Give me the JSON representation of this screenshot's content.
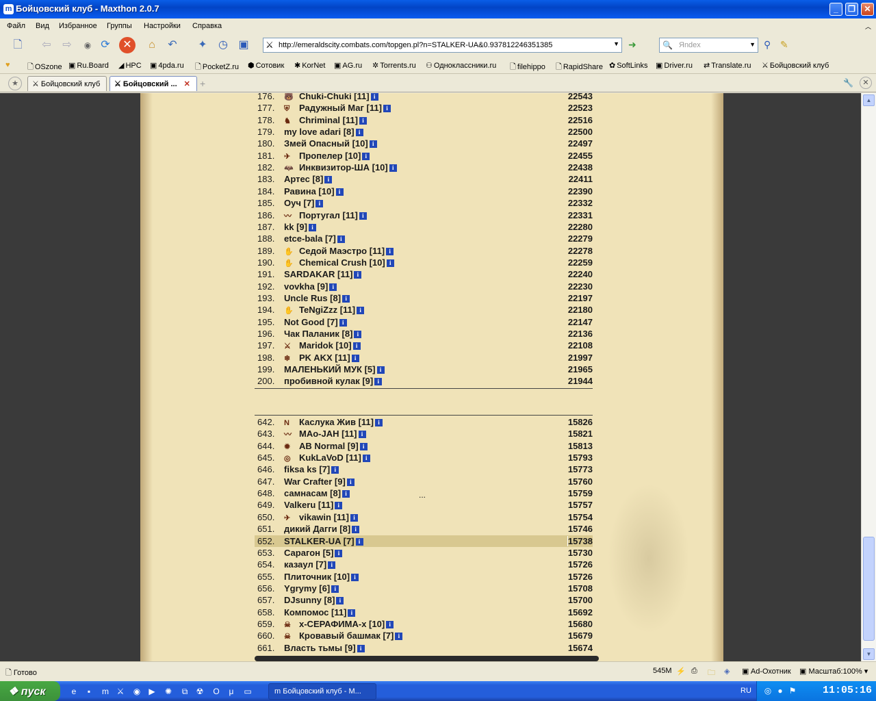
{
  "window": {
    "title": "Бойцовский клуб - Maxthon 2.0.7",
    "app_icon": "m"
  },
  "menu": [
    "Файл",
    "Вид",
    "Избранное",
    "Группы",
    "Настройки",
    "Справка"
  ],
  "address": {
    "url": "http://emeraldscity.combats.com/topgen.pl?n=STALKER-UA&0.937812246351385"
  },
  "search": {
    "placeholder": "Яndex"
  },
  "links": [
    "OSzone",
    "Ru.Board",
    "HPC",
    "4pda.ru",
    "PocketZ.ru",
    "Сотовик",
    "KorNet",
    "AG.ru",
    "Torrents.ru",
    "Одноклассники.ru",
    "filehippo",
    "RapidShare",
    "SoftLinks",
    "Driver.ru",
    "Translate.ru",
    "Бойцовский клуб"
  ],
  "tabs": [
    {
      "label": "Бойцовский клуб"
    },
    {
      "label": "Бойцовский ..."
    }
  ],
  "ranking_top": [
    {
      "rank": "176.",
      "name": "Chuki-Chuki [11]",
      "score": "22543",
      "icon": "🐻"
    },
    {
      "rank": "177.",
      "name": "Радужный Маг [11]",
      "score": "22523",
      "icon": "⛨"
    },
    {
      "rank": "178.",
      "name": "Chriminal [11]",
      "score": "22516",
      "icon": "♞"
    },
    {
      "rank": "179.",
      "name": "my love adari [8]",
      "score": "22500",
      "icon": ""
    },
    {
      "rank": "180.",
      "name": "Змей Опасный [10]",
      "score": "22497",
      "icon": ""
    },
    {
      "rank": "181.",
      "name": "Пропелер [10]",
      "score": "22455",
      "icon": "✈"
    },
    {
      "rank": "182.",
      "name": "Инквизитор-ША [10]",
      "score": "22438",
      "icon": "🦇"
    },
    {
      "rank": "183.",
      "name": "Артес [8]",
      "score": "22411",
      "icon": ""
    },
    {
      "rank": "184.",
      "name": "Равина [10]",
      "score": "22390",
      "icon": ""
    },
    {
      "rank": "185.",
      "name": "Оуч [7]",
      "score": "22332",
      "icon": ""
    },
    {
      "rank": "186.",
      "name": "Португал [11]",
      "score": "22331",
      "icon": "〰"
    },
    {
      "rank": "187.",
      "name": "kk [9]",
      "score": "22280",
      "icon": ""
    },
    {
      "rank": "188.",
      "name": "etce-bala [7]",
      "score": "22279",
      "icon": ""
    },
    {
      "rank": "189.",
      "name": "Седой Маэстро [11]",
      "score": "22278",
      "icon": "✋"
    },
    {
      "rank": "190.",
      "name": "Chemical Crush [10]",
      "score": "22259",
      "icon": "✋"
    },
    {
      "rank": "191.",
      "name": "SARDAKAR [11]",
      "score": "22240",
      "icon": ""
    },
    {
      "rank": "192.",
      "name": "vovkha [9]",
      "score": "22230",
      "icon": ""
    },
    {
      "rank": "193.",
      "name": "Uncle Rus [8]",
      "score": "22197",
      "icon": ""
    },
    {
      "rank": "194.",
      "name": "TeNgiZzz [11]",
      "score": "22180",
      "icon": "✋"
    },
    {
      "rank": "195.",
      "name": "Not Good [7]",
      "score": "22147",
      "icon": ""
    },
    {
      "rank": "196.",
      "name": "Чак Паланик [8]",
      "score": "22136",
      "icon": ""
    },
    {
      "rank": "197.",
      "name": "Maridok [10]",
      "score": "22108",
      "icon": "⚔"
    },
    {
      "rank": "198.",
      "name": "PK AKX [11]",
      "score": "21997",
      "icon": "❄"
    },
    {
      "rank": "199.",
      "name": "МАЛЕНЬКИЙ МУК [5]",
      "score": "21965",
      "icon": ""
    },
    {
      "rank": "200.",
      "name": "пробивной кулак [9]",
      "score": "21944",
      "icon": ""
    }
  ],
  "ellipsis": "...",
  "ranking_bottom": [
    {
      "rank": "642.",
      "name": "Каслука Жив [11]",
      "score": "15826",
      "icon": "N"
    },
    {
      "rank": "643.",
      "name": "МАо-JAH [11]",
      "score": "15821",
      "icon": "〰"
    },
    {
      "rank": "644.",
      "name": "AB Normal [9]",
      "score": "15813",
      "icon": "✹"
    },
    {
      "rank": "645.",
      "name": "KukLaVoD [11]",
      "score": "15793",
      "icon": "◎"
    },
    {
      "rank": "646.",
      "name": "fiksa ks [7]",
      "score": "15773",
      "icon": ""
    },
    {
      "rank": "647.",
      "name": "War Crafter [9]",
      "score": "15760",
      "icon": ""
    },
    {
      "rank": "648.",
      "name": "самнасам [8]",
      "score": "15759",
      "icon": ""
    },
    {
      "rank": "649.",
      "name": "Valkeru [11]",
      "score": "15757",
      "icon": ""
    },
    {
      "rank": "650.",
      "name": "vikawin [11]",
      "score": "15754",
      "icon": "✈"
    },
    {
      "rank": "651.",
      "name": "дикий Дагги [8]",
      "score": "15746",
      "icon": ""
    },
    {
      "rank": "652.",
      "name": "STALKER-UA [7]",
      "score": "15738",
      "icon": "",
      "highlight": true
    },
    {
      "rank": "653.",
      "name": "Сарагон [5]",
      "score": "15730",
      "icon": ""
    },
    {
      "rank": "654.",
      "name": "казаул [7]",
      "score": "15726",
      "icon": ""
    },
    {
      "rank": "655.",
      "name": "Плиточник [10]",
      "score": "15726",
      "icon": ""
    },
    {
      "rank": "656.",
      "name": "Ygrymy [6]",
      "score": "15708",
      "icon": ""
    },
    {
      "rank": "657.",
      "name": "DJsunny [8]",
      "score": "15700",
      "icon": ""
    },
    {
      "rank": "658.",
      "name": "Компомос [11]",
      "score": "15692",
      "icon": ""
    },
    {
      "rank": "659.",
      "name": "х-СЕРАФИМА-х [10]",
      "score": "15680",
      "icon": "☠"
    },
    {
      "rank": "660.",
      "name": "Кровавый башмак [7]",
      "score": "15679",
      "icon": "☠"
    },
    {
      "rank": "661.",
      "name": "Власть тьмы [9]",
      "score": "15674",
      "icon": ""
    }
  ],
  "info_glyph": "i",
  "status": {
    "text": "Готово",
    "memory": "545M",
    "adhunter": "Ad-Охотник",
    "zoom": "Масштаб:100%"
  },
  "taskbar": {
    "start": "пуск",
    "window": "Бойцовский клуб - М...",
    "lang": "RU",
    "clock": "11:05:16"
  }
}
